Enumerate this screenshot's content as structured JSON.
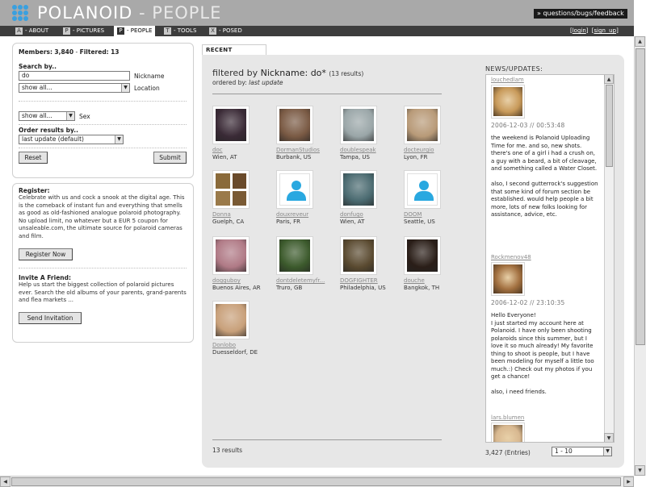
{
  "header": {
    "brand": "POLANOID",
    "brand_sep": " - ",
    "brand_section": "PEOPLE",
    "feedback_link": "» questions/bugs/feedback"
  },
  "nav": {
    "items": [
      {
        "key": "A",
        "label": "- ABOUT"
      },
      {
        "key": "P",
        "label": "- PICTURES"
      },
      {
        "key": "P",
        "label": "- PEOPLE",
        "active": true
      },
      {
        "key": "T",
        "label": "- TOOLS"
      },
      {
        "key": "X",
        "label": "- POSED"
      }
    ],
    "login": "login",
    "signup": "sign up"
  },
  "search": {
    "members_label": "Members:",
    "members_count": "3,840",
    "filtered_label": "Filtered:",
    "filtered_count": "13",
    "search_by_label": "Search by..",
    "nickname_value": "do",
    "nickname_label": "Nickname",
    "location_value": "show all...",
    "location_label": "Location",
    "sex_value": "show all...",
    "sex_label": "Sex",
    "order_label": "Order results by..",
    "order_value": "last update (default)",
    "reset": "Reset",
    "submit": "Submit"
  },
  "register": {
    "title": "Register:",
    "text": "Celebrate with us and cock a snook at the digital age. This is the comeback of instant fun and everything that smells as good as old-fashioned analogue polaroid photography. No upload limit, no whatever but a EUR 5 coupon for unsaleable.com, the ultimate source for polaroid cameras and film.",
    "button": "Register Now",
    "invite_title": "Invite A Friend:",
    "invite_text": "Help us start the biggest collection of polaroid pictures ever. Search the old albums of your parents, grand-parents and flea markets ...",
    "invite_button": "Send Invitation"
  },
  "tab": {
    "label": "RECENT PROFILES"
  },
  "filter": {
    "prefix": "filtered by",
    "field": "Nickname: do*",
    "count": "(13 results)",
    "ordered_by": "ordered by:",
    "ordered_value": "last update",
    "results": "13 results"
  },
  "profiles": [
    {
      "name": "doc",
      "loc": "Wien, AT",
      "color": "#3a2a36"
    },
    {
      "name": "DormanStudios",
      "loc": "Burbank, US",
      "color": "#7a5a44"
    },
    {
      "name": "doublespeak",
      "loc": "Tampa, US",
      "color": "#9aa6a8"
    },
    {
      "name": "docteurgio",
      "loc": "Lyon, FR",
      "color": "#b89a78"
    },
    {
      "name": "Donna",
      "loc": "Guelph, CA",
      "color": "quad"
    },
    {
      "name": "douxreveur",
      "loc": "Paris, FR",
      "color": "avatar"
    },
    {
      "name": "donfugo",
      "loc": "Wien, AT",
      "color": "#4a6a70"
    },
    {
      "name": "DOOM",
      "loc": "Seattle, US",
      "color": "avatar"
    },
    {
      "name": "dogguboy",
      "loc": "Buenos Aires, AR",
      "color": "#b07a86"
    },
    {
      "name": "dontdeletemyfr...",
      "loc": "Truro, GB",
      "color": "#3c5a2c"
    },
    {
      "name": "DOGFIGHTER",
      "loc": "Philadelphia, US",
      "color": "#5a4a30"
    },
    {
      "name": "douche",
      "loc": "Bangkok, TH",
      "color": "#2a1e18"
    },
    {
      "name": "Donlobo",
      "loc": "Duesseldorf, DE",
      "color": "#c8a07a"
    }
  ],
  "news": {
    "heading": "NEWS/UPDATES:",
    "items": [
      {
        "user": "louchedlam",
        "date": "2006-12-03 // 00:53:48",
        "text": "the weekend is Polanoid Uploading Time for me. and so, new shots. there's one of a girl i had a crush on, a guy with a beard, a bit of cleavage, and something called a Water Closet.\n\nalso, I second gutterrock's suggestion that some kind of forum section be established. would help people a bit more, lots of new folks looking for assistance, advice, etc.",
        "color": "#c89a5a"
      },
      {
        "user": "Rockmenov48",
        "date": "2006-12-02 // 23:10:35",
        "text": "Hello Everyone!\nI just started my account here at Polanoid. I have only been shooting polaroids since this summer, but I love it so much already! My favorite thing to shoot is people, but I have been modeling for myself a little too much.:) Check out my photos if you get a chance!\n\nalso, i need friends.",
        "color": "#a27040"
      },
      {
        "user": "lars.blumen",
        "date": "",
        "text": "",
        "color": "#d8b890"
      }
    ],
    "entries": "3,427 (Entries)",
    "page_value": "1 - 10"
  },
  "colors": {
    "accent": "#3aa0df",
    "nav_bg": "#3d3d3d",
    "header_bg": "#a9a9a9",
    "panel_bg": "#e7e7e7"
  }
}
